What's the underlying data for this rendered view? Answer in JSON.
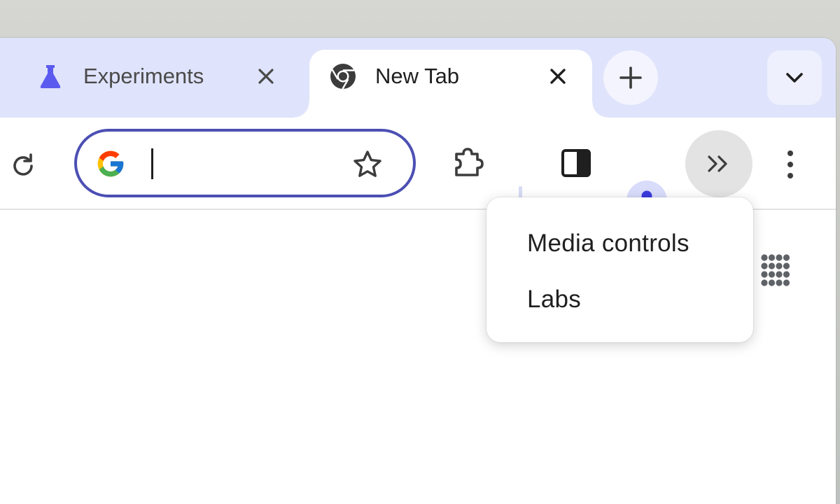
{
  "tabs": [
    {
      "title": "Experiments",
      "icon": "flask-icon",
      "active": false
    },
    {
      "title": "New Tab",
      "icon": "chrome-icon",
      "active": true
    }
  ],
  "tabstrip": {
    "new_tab_icon": "plus-icon",
    "tab_search_icon": "chevron-down-icon"
  },
  "toolbar": {
    "reload_icon": "reload-icon",
    "omnibox": {
      "value": "",
      "placeholder": "",
      "search_engine_icon": "google-icon"
    },
    "bookmark_icon": "star-outline-icon",
    "extensions_icon": "puzzle-icon",
    "side_panel_icon": "side-panel-icon",
    "profile_icon": "person-icon",
    "overflow_icon": "double-chevron-right-icon",
    "menu_icon": "three-dots-vertical-icon"
  },
  "overflow_menu": {
    "items": [
      {
        "label": "Media controls"
      },
      {
        "label": "Labs"
      }
    ]
  },
  "content": {
    "apps_icon": "apps-grid-icon"
  },
  "colors": {
    "tabstrip_bg": "#dfe3fb",
    "omnibox_border": "#4c4fb3",
    "flask_accent": "#5b5bf0",
    "profile_accent": "#3a3adf"
  }
}
